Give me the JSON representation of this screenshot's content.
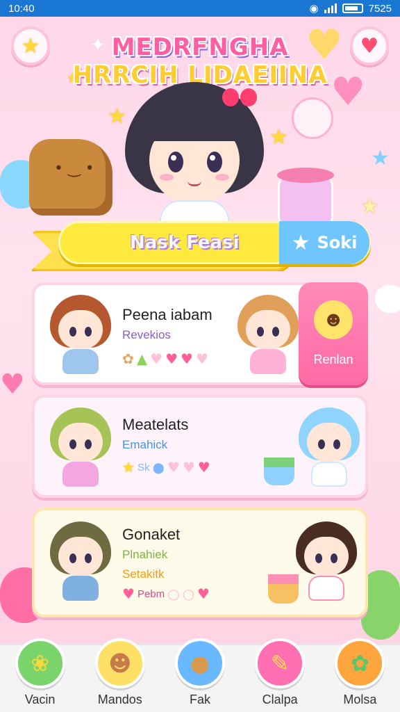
{
  "status_bar": {
    "time": "10:40",
    "right_text": "7525"
  },
  "title": {
    "line1": "MEDRFNGHA",
    "line2": "HRRCIH LJDAEIINA"
  },
  "top_buttons": {
    "left_icon": "star-icon",
    "right_icon": "heart-icon"
  },
  "banner": {
    "label": "Nask Feasi",
    "action_label": "Soki",
    "action_icon": "star-icon"
  },
  "cards": [
    {
      "name": "Peena iabam",
      "sub": "Revekios",
      "sub2": "",
      "icon_text": "",
      "button_label": "Renlan",
      "colors": {
        "hair": "#b5572f",
        "body": "#9fc7ee",
        "sub": "#8b5fc7"
      }
    },
    {
      "name": "Meatelats",
      "sub": "Emahick",
      "sub2": "",
      "icon_text": "Sk",
      "colors": {
        "hair": "#a6c456",
        "body": "#f4a6e0",
        "sub": "#4a90e2"
      }
    },
    {
      "name": "Gonaket",
      "sub": "Plnahiek",
      "sub2": "Setakitk",
      "icon_text": "Pebm",
      "colors": {
        "hair": "#6f6a3f",
        "body": "#7fb0e0",
        "sub": "#7cb342",
        "sub2": "#f39c12"
      }
    }
  ],
  "bottom_nav": [
    {
      "label": "Vacin",
      "icon": "leaf-icon",
      "color": "#7ad36b"
    },
    {
      "label": "Mandos",
      "icon": "face-icon",
      "color": "#ffe066"
    },
    {
      "label": "Fak",
      "icon": "bun-icon",
      "color": "#6ab8ff"
    },
    {
      "label": "Clalpa",
      "icon": "tool-icon",
      "color": "#ff6fb1"
    },
    {
      "label": "Molsa",
      "icon": "bear-icon",
      "color": "#ffa53d"
    }
  ]
}
